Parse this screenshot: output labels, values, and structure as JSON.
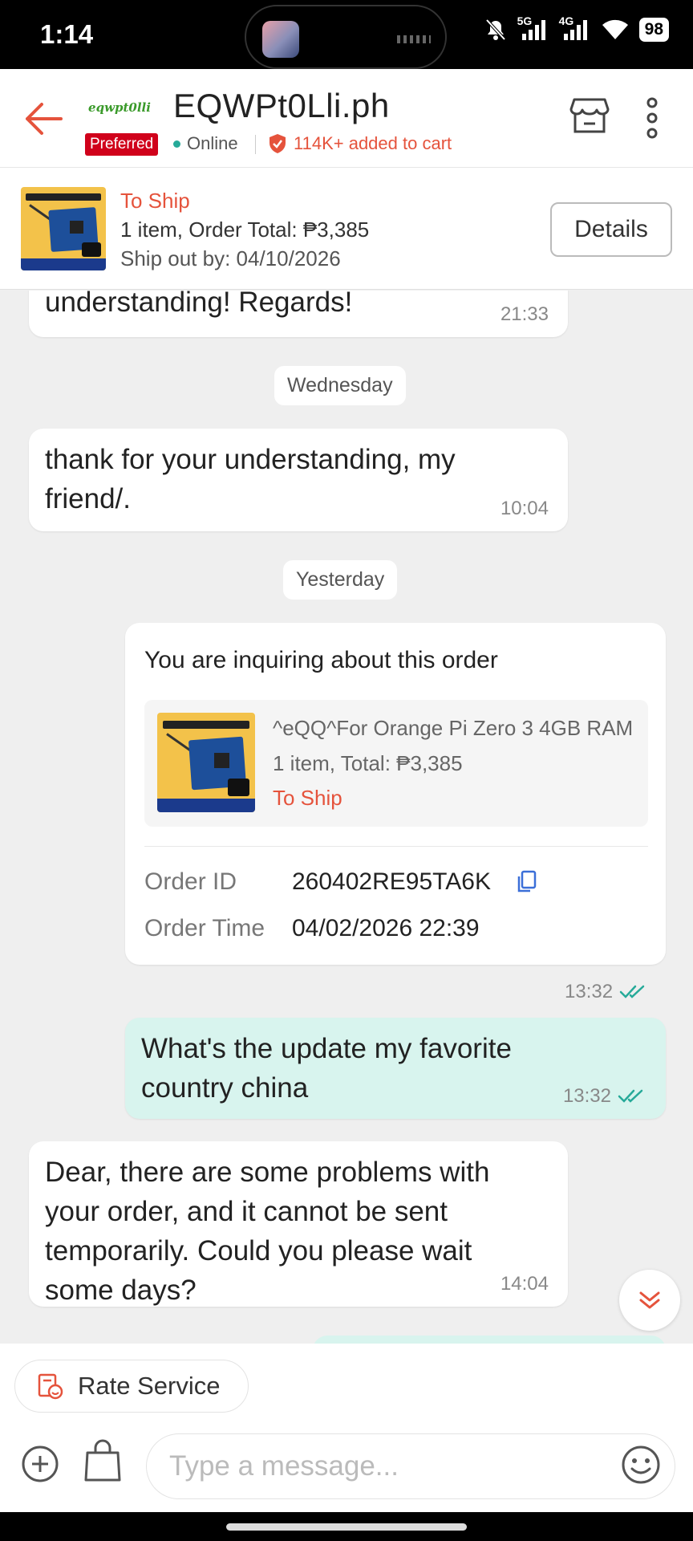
{
  "status_bar": {
    "time": "1:14",
    "network1": "5G",
    "network2": "4G",
    "battery": "98"
  },
  "header": {
    "shop_logo_text": "eqwpt0lli",
    "shop_name": "EQWPt0Lli.ph",
    "preferred_badge": "Preferred",
    "online_status": "Online",
    "cart_info": "114K+ added to cart",
    "accent_color": "#e5533c"
  },
  "order_bar": {
    "status": "To Ship",
    "summary": "1 item, Order Total: ₱3,385",
    "ship_by": "Ship out by: 04/10/2026",
    "details_label": "Details"
  },
  "messages": {
    "m1": {
      "text": "understanding! Regards!",
      "time": "21:33"
    },
    "date1": "Wednesday",
    "m2": {
      "text": "thank for your understanding, my friend/.",
      "time": "10:04"
    },
    "date2": "Yesterday",
    "order_card": {
      "title": "You are inquiring about this order",
      "product_name": "^eQQ^For Orange Pi Zero 3 4GB RAM",
      "items_total": "1 item, Total: ₱3,385",
      "status": "To Ship",
      "order_id_label": "Order ID",
      "order_id": "260402RE95TA6K",
      "order_time_label": "Order Time",
      "order_time": "04/02/2026 22:39",
      "time": "13:32"
    },
    "m3": {
      "text": "What's the update my favorite country china",
      "time": "13:32"
    },
    "m4": {
      "text": "Dear, there are some problems with your order, and it cannot be sent temporarily. Could you please wait some days?",
      "time": "14:04"
    }
  },
  "bottom": {
    "rate_service": "Rate Service",
    "input_placeholder": "Type a message..."
  }
}
